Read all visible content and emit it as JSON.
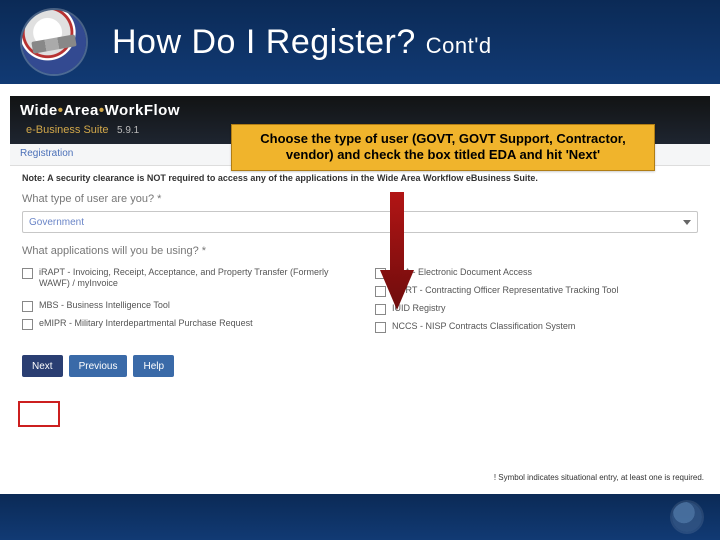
{
  "slide": {
    "title_main": "How Do I Register? ",
    "title_sub": "Cont'd"
  },
  "callout": {
    "text": "Choose the type of user (GOVT, GOVT Support, Contractor, vendor) and check the box  titled EDA and hit 'Next'"
  },
  "app": {
    "brand_prefix": "Wide",
    "brand_mid": "Area",
    "brand_suffix": "WorkFlow",
    "subbrand": "e-Business Suite",
    "version": "5.9.1",
    "breadcrumb": "Registration",
    "note": "Note: A security clearance is NOT required to access any of the applications in the Wide Area Workflow eBusiness Suite.",
    "q_user_type": "What type of user are you? *",
    "user_type_value": "Government",
    "q_apps": "What applications will you be using? *",
    "apps_left": [
      "iRAPT - Invoicing, Receipt, Acceptance, and Property Transfer (Formerly WAWF) / myInvoice",
      "MBS - Business Intelligence Tool",
      "eMIPR - Military Interdepartmental Purchase Request"
    ],
    "apps_right": [
      "EDA - Electronic Document Access",
      "CORT - Contracting Officer Representative Tracking Tool",
      "IUID Registry",
      "NCCS - NISP Contracts Classification System"
    ],
    "buttons": {
      "next": "Next",
      "prev": "Previous",
      "help": "Help"
    },
    "footnote": "! Symbol indicates situational entry, at least one is required."
  }
}
